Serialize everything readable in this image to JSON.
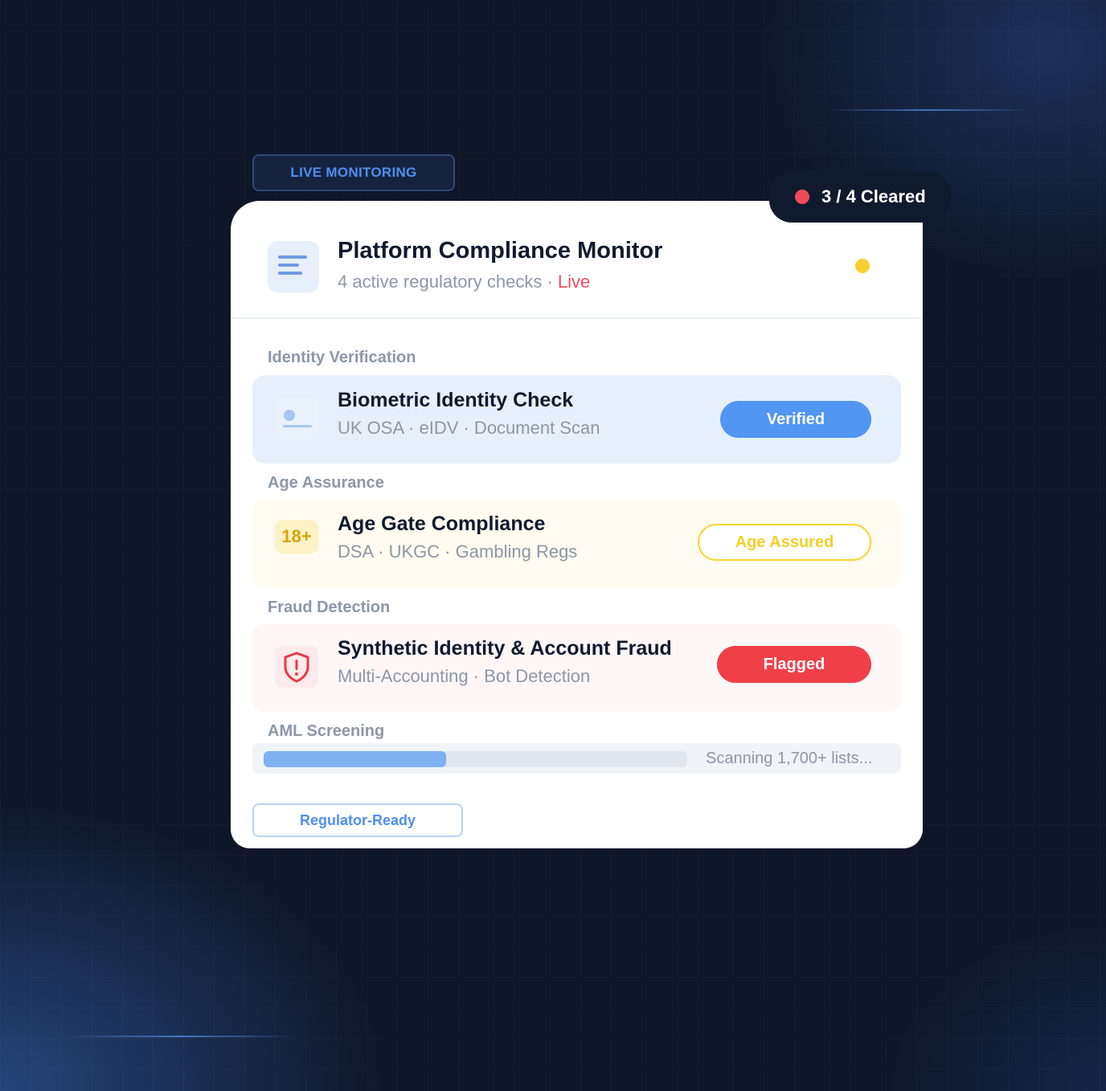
{
  "top_tag": "LIVE MONITORING",
  "cleared": {
    "text": "3 / 4 Cleared",
    "dot_color": "#f04a5a"
  },
  "header": {
    "icon": "menu-lines-icon",
    "title": "Platform Compliance Monitor",
    "subtitle": "4 active regulatory checks · ",
    "live": "Live",
    "status_dot_color": "#f8d02e"
  },
  "sections": [
    {
      "label": "Identity Verification",
      "title": "Biometric Identity Check",
      "meta": "UK OSA · eIDV · Document Scan",
      "icon": "id-card-icon",
      "badge": "Verified"
    },
    {
      "label": "Age Assurance",
      "title": "Age Gate Compliance",
      "meta": "DSA · UKGC · Gambling Regs",
      "icon_text": "18+",
      "badge": "Age Assured"
    },
    {
      "label": "Fraud Detection",
      "title": "Synthetic Identity & Account Fraud",
      "meta": "Multi-Accounting · Bot Detection",
      "icon": "shield-alert-icon",
      "badge": "Flagged"
    }
  ],
  "aml": {
    "label": "AML Screening",
    "progress": 0.43,
    "status": "Scanning 1,700+ lists..."
  },
  "footer_button": "Regulator-Ready",
  "colors": {
    "accent_blue": "#4f8ff0",
    "verified_bg": "#e6f0fc",
    "assured_bg": "#fffbf0",
    "assured_border": "#f8d52e",
    "flagged": "#ef4048",
    "fraud_bg": "#fff6f6"
  }
}
